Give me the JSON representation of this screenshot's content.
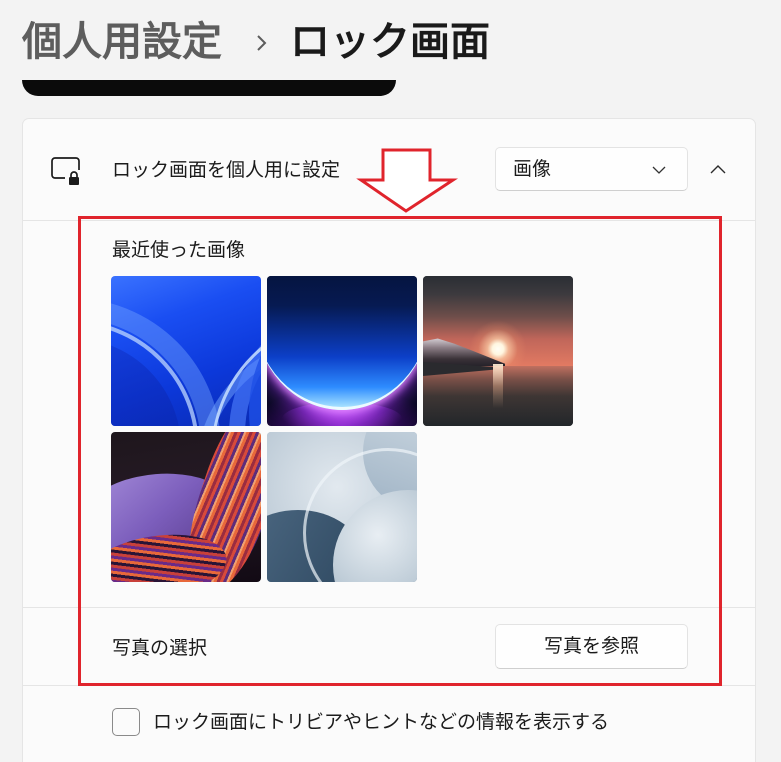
{
  "breadcrumb": {
    "parent": "個人用設定",
    "separator_icon": "chevron-right-icon",
    "current": "ロック画面"
  },
  "lock_screen_card": {
    "icon": "lock-screen-icon",
    "label": "ロック画面を個人用に設定",
    "dropdown": {
      "selected": "画像",
      "icon": "chevron-down-icon"
    },
    "collapse_icon": "chevron-up-icon",
    "recent_images_heading": "最近使った画像",
    "choose_photo": {
      "label": "写真の選択",
      "button": "写真を参照"
    }
  },
  "trivia_option": {
    "label": "ロック画面にトリビアやヒントなどの情報を表示する",
    "checked": false
  },
  "annotation": {
    "arrow_icon": "arrow-down-icon"
  },
  "colors": {
    "annotation_red": "#e0242c",
    "breadcrumb_parent": "#5d5d5d",
    "text_primary": "#1b1b1b"
  }
}
